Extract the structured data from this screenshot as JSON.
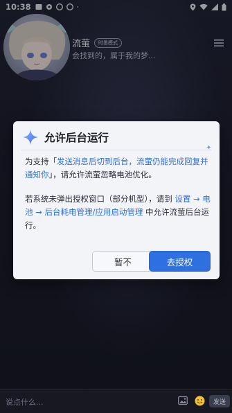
{
  "statusbar": {
    "time": "10:38"
  },
  "header": {
    "name": "流萤",
    "badge": "时墨模式",
    "subtitle": "会找到的，属于我的梦..."
  },
  "dialog": {
    "title": "允许后台运行",
    "para1_prefix": "为支持「",
    "para1_highlight": "发送消息后切到后台，流萤仍能完成回复并通知你",
    "para1_suffix": "」，请允许流萤忽略电池优化。",
    "para2_prefix": "若系统未弹出授权窗口（部分机型），请到 ",
    "para2_highlight": "设置 → 电池 → 后台耗电管理/应用启动管理",
    "para2_suffix": " 中允许流萤后台运行。",
    "btn_later": "暂不",
    "btn_auth": "去授权"
  },
  "composer": {
    "placeholder": "说点什么...",
    "send_label": "发送"
  },
  "colors": {
    "accent": "#2f70e0",
    "highlight_text": "#2f6fd7",
    "dialog_bg": "#f3f4f8"
  }
}
